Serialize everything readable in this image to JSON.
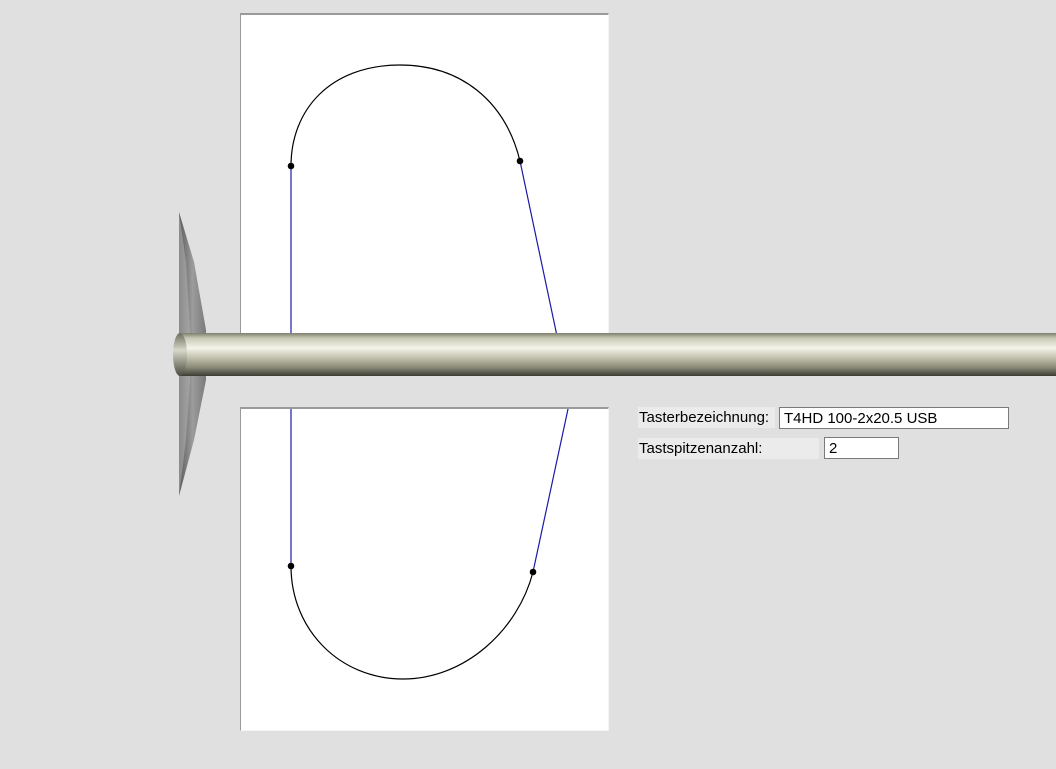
{
  "form": {
    "probe_name_label": "Tasterbezeichnung:",
    "probe_name_value": "T4HD 100-2x20.5 USB",
    "tip_count_label": "Tastspitzenanzahl:",
    "tip_count_value": "2"
  },
  "colors": {
    "background": "#e0e0e0",
    "panel": "#ffffff",
    "contour_arc": "#000000",
    "contour_line": "#1a1aa8",
    "shaft": "#b8b8a4",
    "flange": "#8a8a8a"
  }
}
